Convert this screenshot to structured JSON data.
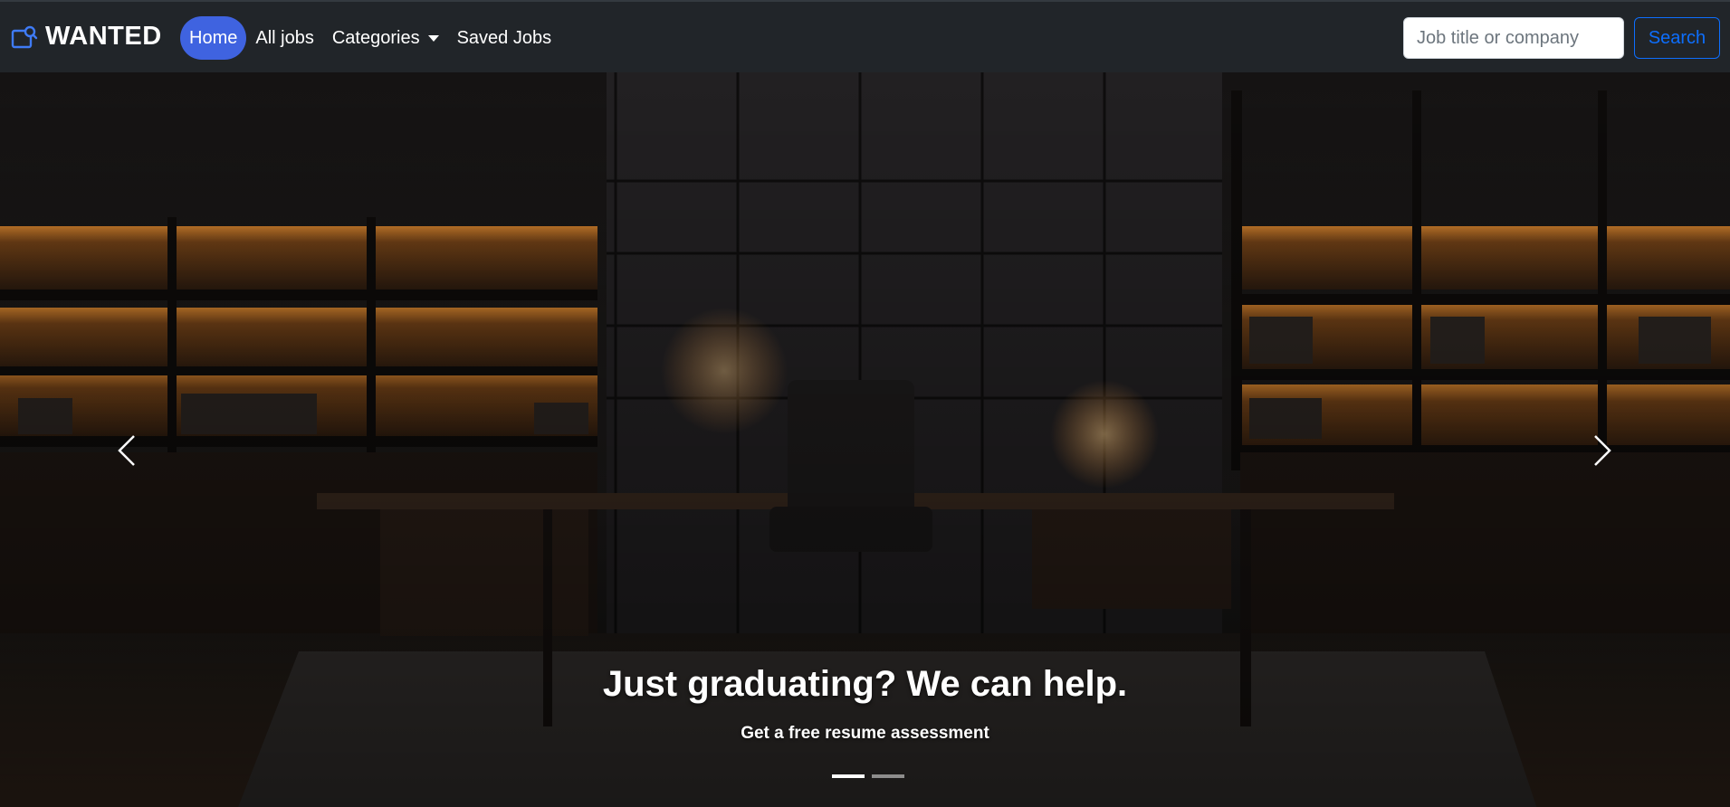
{
  "brand": {
    "name": "WANTED",
    "icon": "briefcase-search-icon",
    "icon_color": "#3f7bf6"
  },
  "nav": {
    "items": [
      {
        "label": "Home",
        "active": true
      },
      {
        "label": "All jobs",
        "active": false
      },
      {
        "label": "Categories",
        "active": false,
        "dropdown": true
      },
      {
        "label": "Saved Jobs",
        "active": false
      }
    ]
  },
  "search": {
    "placeholder": "Job title or company",
    "value": "",
    "button_label": "Search"
  },
  "hero": {
    "title": "Just graduating? We can help.",
    "subtitle": "Get a free resume assessment",
    "prev_icon": "chevron-left-icon",
    "next_icon": "chevron-right-icon",
    "slides_count": 2,
    "active_slide": 1
  },
  "colors": {
    "navbar_bg": "#212529",
    "accent": "#3f63e0",
    "search_button": "#0d6efd"
  }
}
